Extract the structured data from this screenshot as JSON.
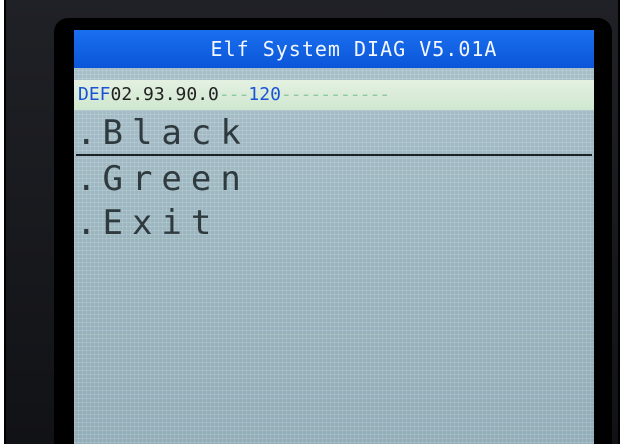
{
  "header": {
    "title": "Elf System DIAG V5.01A"
  },
  "info": {
    "prefix": "DEF",
    "version": "02.93.90.0",
    "dash1": "---",
    "number": "120",
    "dash2": "-----------"
  },
  "menu": {
    "items": [
      {
        "label": "Black",
        "selected": true
      },
      {
        "label": "Green",
        "selected": false
      },
      {
        "label": "Exit",
        "selected": false
      }
    ],
    "bullet": "."
  },
  "colors": {
    "title_bar": "#0b56d8",
    "info_bar": "#d6ecd5",
    "screen": "#9fb8c2",
    "accent_text": "#1a53d6"
  }
}
